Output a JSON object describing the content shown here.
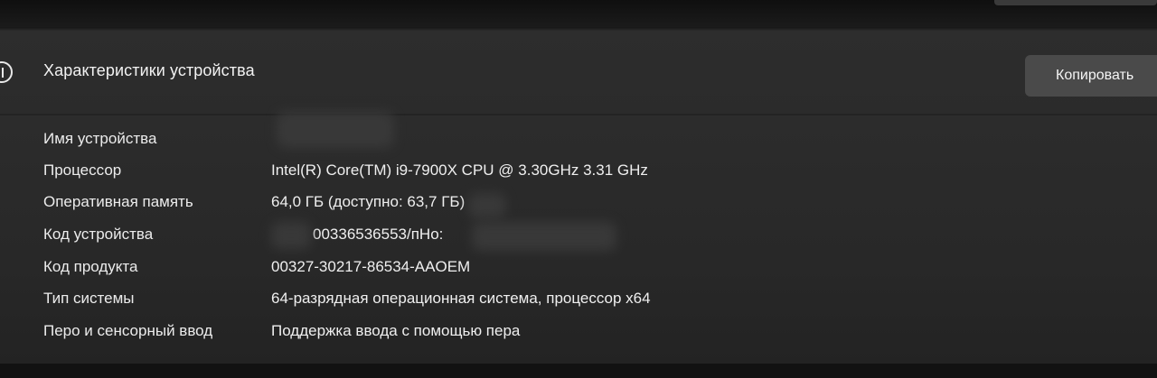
{
  "header": {
    "title": "Характеристики устройства",
    "copy_label": "Копировать"
  },
  "specs": [
    {
      "label": "Имя устройства",
      "value": ""
    },
    {
      "label": "Процессор",
      "value": "Intel(R) Core(TM) i9-7900X CPU @ 3.30GHz   3.31 GHz"
    },
    {
      "label": "Оперативная память",
      "value": "64,0 ГБ (доступно: 63,7 ГБ)"
    },
    {
      "label": "Код устройства",
      "value": "00336536553/пНо:"
    },
    {
      "label": "Код продукта",
      "value": "00327-30217-86534-AAOEM"
    },
    {
      "label": "Тип системы",
      "value": "64-разрядная операционная система, процессор x64"
    },
    {
      "label": "Перо и сенсорный ввод",
      "value": "Поддержка ввода с помощью пера"
    }
  ],
  "icons": {
    "header_icon": "info-icon"
  }
}
